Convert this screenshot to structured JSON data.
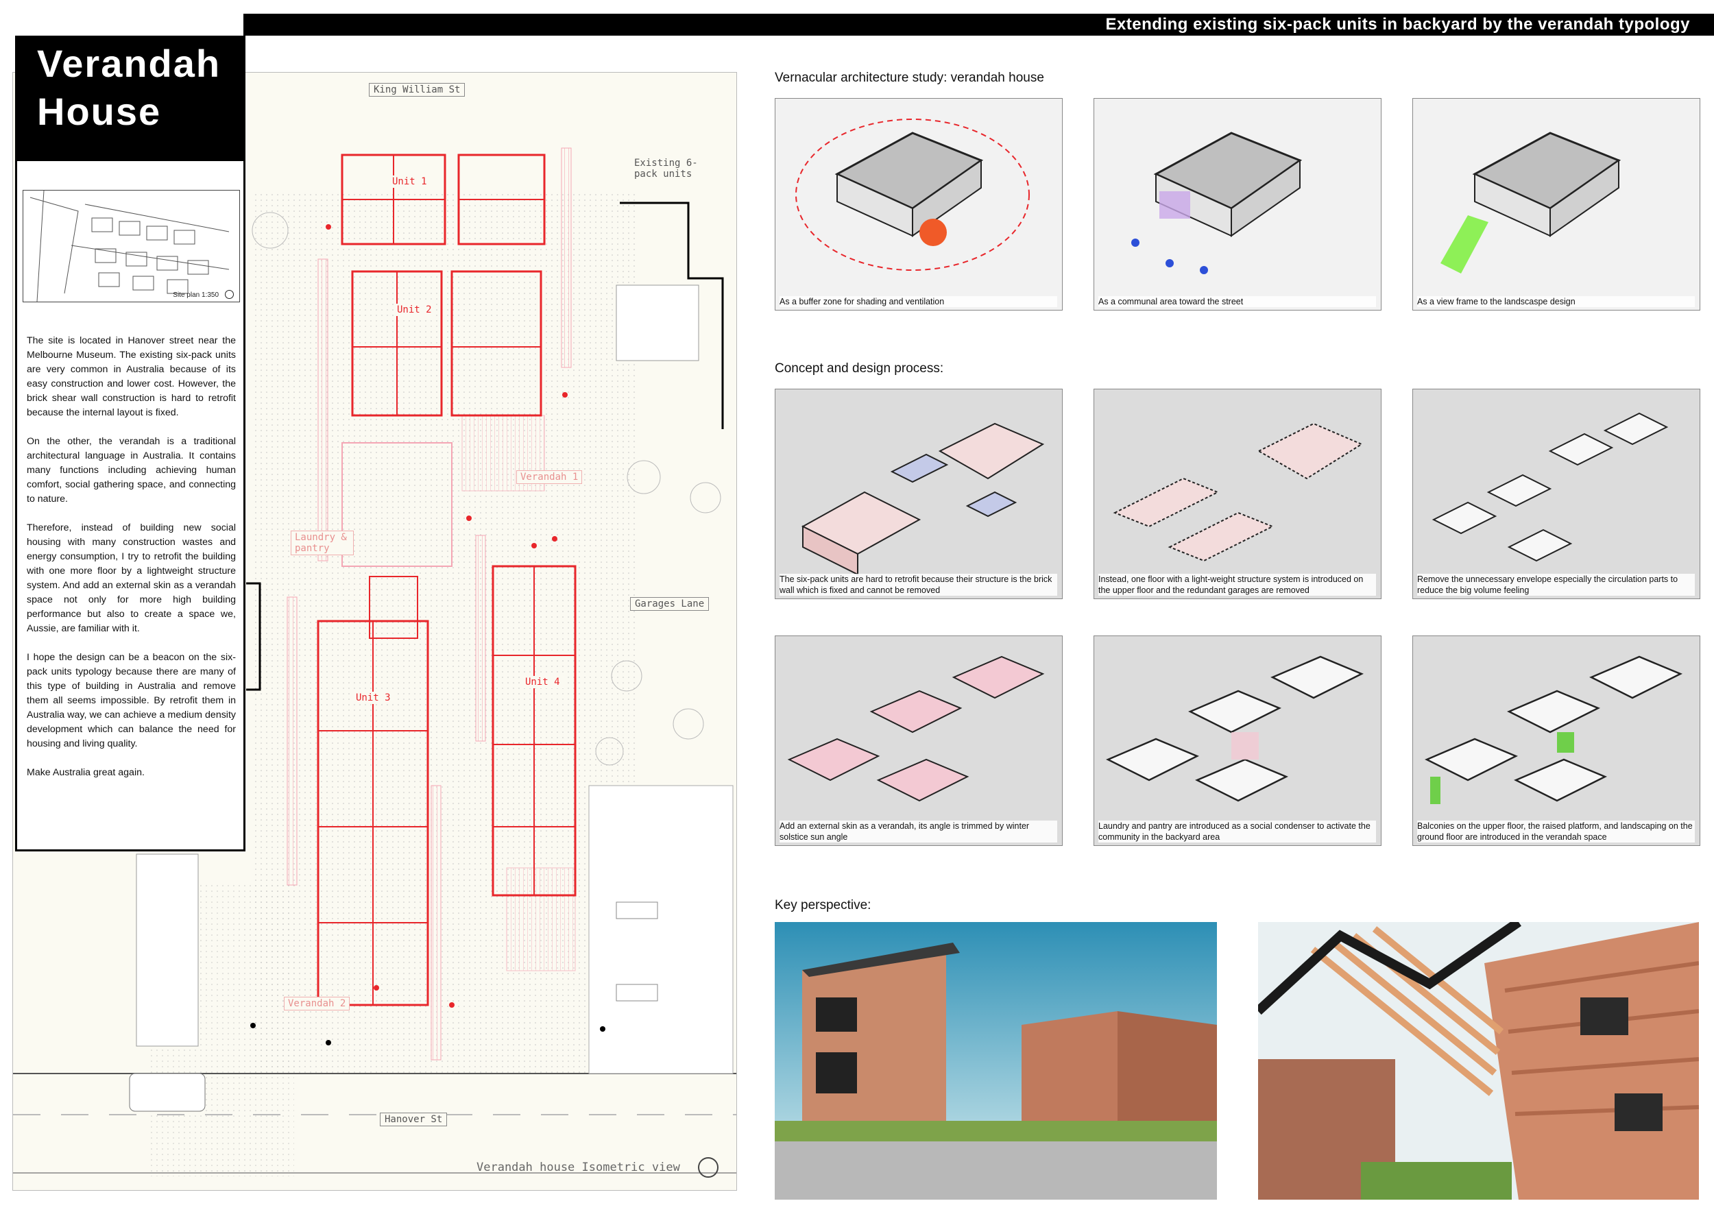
{
  "banner": {
    "text": "Extending existing six-pack units in backyard  by the verandah typology"
  },
  "title": {
    "line1": "Verandah",
    "line2": "House"
  },
  "site_plan": {
    "label": "Site plan 1:350"
  },
  "description": {
    "paragraphs": [
      "The site is located in Hanover street near the Melbourne Museum. The existing six-pack units are very common in Australia because of its easy construction and lower cost. However, the brick shear wall construction is hard to retrofit because the internal layout is fixed.",
      "On the other, the verandah is a traditional architectural language in Australia. It contains many functions including achieving human comfort, social gathering space, and connecting to nature.",
      "Therefore, instead of building new social housing with many construction wastes and energy consumption, I try to retrofit the building with one more floor by a lightweight structure system. And add an external skin as a verandah space not only for more high building performance but also to create a space we, Aussie, are familiar with it.",
      "I hope the design can be a beacon on the six-pack units typology because there are many of this type of building in Australia and remove them all seems impossible. By retrofit them in Australia way, we can achieve a medium density development which can balance the need for housing and living quality.",
      "Make Australia great again."
    ]
  },
  "plan": {
    "streets": {
      "top": "King William St",
      "right": "Garages Lane",
      "bottom": "Hanover St"
    },
    "existing_label": "Existing 6-pack units",
    "units": [
      "Unit 1",
      "Unit 2",
      "Unit 3",
      "Unit 4"
    ],
    "verandah_labels": [
      "Verandah 1",
      "Verandah 2"
    ],
    "laundry_label": "Laundry & pantry",
    "caption": "Verandah house Isometric view"
  },
  "sections": {
    "vernacular": {
      "heading": "Vernacular architecture study: verandah house",
      "captions": [
        "As a buffer zone for shading and ventilation",
        "As a communal area toward the street",
        "As a view frame to the landscaspe design"
      ]
    },
    "concept": {
      "heading": "Concept and design process:",
      "captions": [
        "The six-pack units are hard to retrofit because their structure is the brick wall which is fixed and cannot be removed",
        "Instead, one floor with a light-weight structure system is introduced on the upper floor and the redundant garages are removed",
        "Remove the unnecessary envelope especially the circulation parts to reduce the big volume feeling",
        "Add an external skin as a verandah, its angle is trimmed by winter solstice sun angle",
        "Laundry and pantry are introduced as a social condenser to activate the community in the backyard area",
        "Balconies on the upper floor, the raised platform, and landscaping on the ground floor are introduced in the verandah space"
      ]
    },
    "perspective": {
      "heading": "Key perspective:"
    }
  },
  "colors": {
    "accent_red": "#e8262b",
    "verandah_pink": "#f4a6b4",
    "background": "#fbfaf2"
  }
}
